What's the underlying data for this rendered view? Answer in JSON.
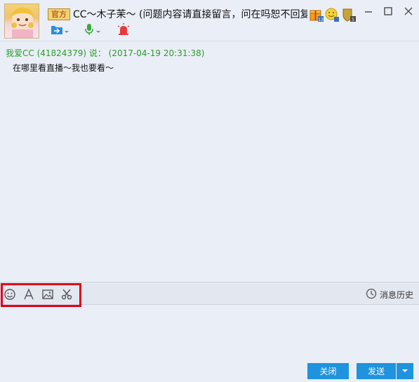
{
  "header": {
    "badge": "官方",
    "title": "CC～木子茉～ (问题内容请直接留言，问在吗恕不回复",
    "icons": [
      "gift-icon",
      "smile-face-icon",
      "shield-icon"
    ],
    "toolbar_icons": [
      "file-transfer-icon",
      "voice-call-icon",
      "alarm-icon"
    ],
    "window_controls": [
      "minimize",
      "maximize",
      "close"
    ]
  },
  "messages": [
    {
      "sender": "我爱CC (41824379) 说：  (2017-04-19 20:31:38)",
      "text": "在哪里看直播～我也要看～"
    }
  ],
  "editbar": {
    "tools": [
      "emoji-icon",
      "font-icon",
      "image-icon",
      "scissors-icon"
    ],
    "history_label": "消息历史"
  },
  "buttons": {
    "close_label": "关闭",
    "send_label": "发送"
  },
  "colors": {
    "background": "#eaeef6",
    "sender_text": "#2a9d2a",
    "button": "#1f93dd",
    "highlight": "#e0001b",
    "badge": "#f3d270"
  }
}
